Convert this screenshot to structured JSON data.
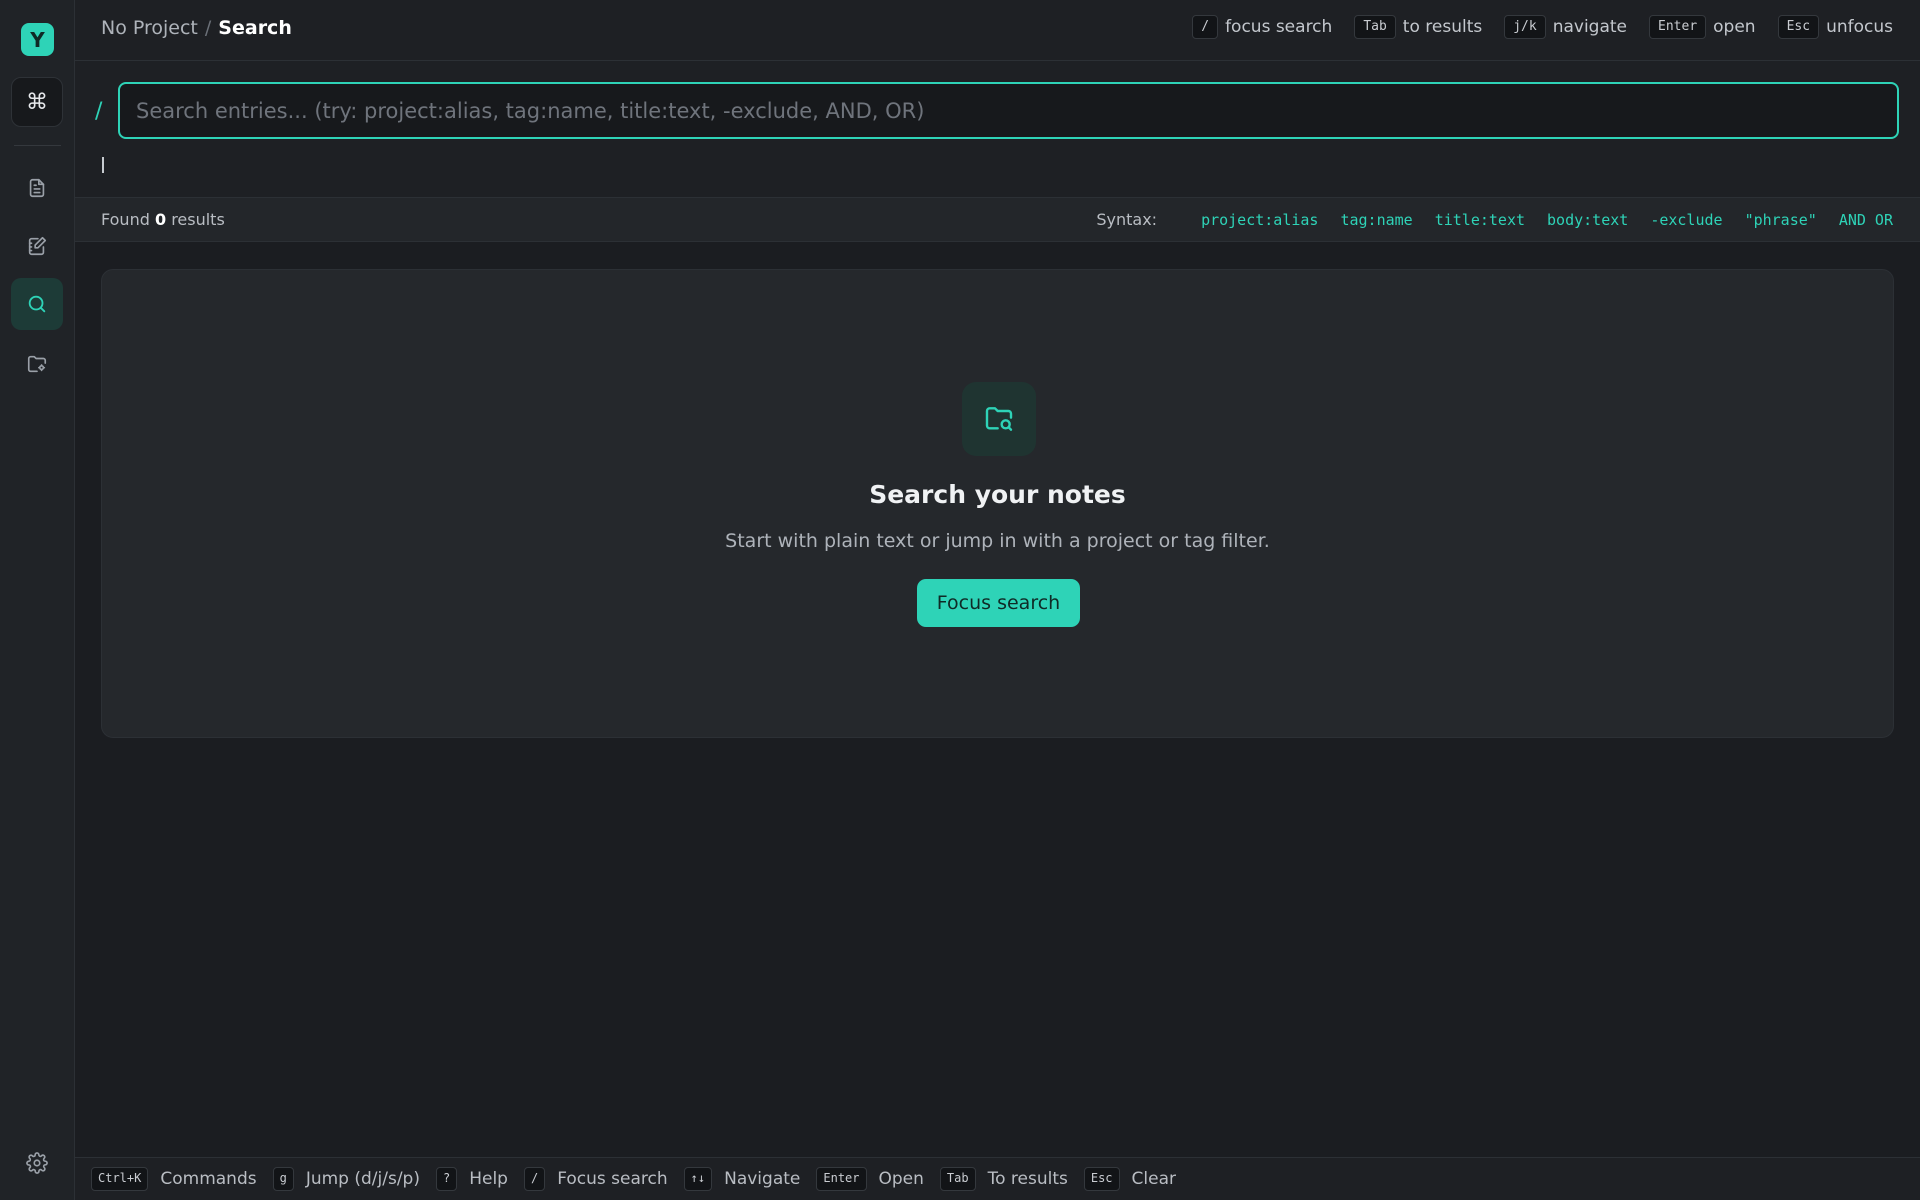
{
  "sidebar": {
    "logo_letter": "Y",
    "command_symbol": "⌘",
    "nav": [
      {
        "name": "notes",
        "icon": "document-icon"
      },
      {
        "name": "journal",
        "icon": "edit-note-icon"
      },
      {
        "name": "search",
        "icon": "search-icon",
        "active": true
      },
      {
        "name": "projects",
        "icon": "folder-icon"
      }
    ],
    "settings_icon": "gear-icon"
  },
  "header": {
    "project": "No Project",
    "separator": "/",
    "page": "Search",
    "hints": [
      {
        "key": "/",
        "label": "focus search"
      },
      {
        "key": "Tab",
        "label": "to results"
      },
      {
        "key": "j/k",
        "label": "navigate"
      },
      {
        "key": "Enter",
        "label": "open"
      },
      {
        "key": "Esc",
        "label": "unfocus"
      }
    ]
  },
  "search": {
    "prefix": "/",
    "value": "",
    "placeholder": "Search entries... (try: project:alias, tag:name, title:text, -exclude, AND, OR)"
  },
  "results": {
    "found_prefix": "Found",
    "count": "0",
    "found_suffix": "results",
    "syntax_label": "Syntax:",
    "syntax": [
      "project:alias",
      "tag:name",
      "title:text",
      "body:text",
      "-exclude",
      "\"phrase\"",
      "AND OR"
    ]
  },
  "empty_state": {
    "icon": "folder-search-icon",
    "title": "Search your notes",
    "subtitle": "Start with plain text or jump in with a project or tag filter.",
    "button": "Focus search"
  },
  "footer": {
    "hints": [
      {
        "key": "Ctrl+K",
        "label": "Commands"
      },
      {
        "key": "g",
        "label": "Jump (d/j/s/p)"
      },
      {
        "key": "?",
        "label": "Help"
      },
      {
        "key": "/",
        "label": "Focus search"
      },
      {
        "key": "↑↓",
        "label": "Navigate"
      },
      {
        "key": "Enter",
        "label": "Open"
      },
      {
        "key": "Tab",
        "label": "To results"
      },
      {
        "key": "Esc",
        "label": "Clear"
      }
    ]
  },
  "colors": {
    "accent": "#2ed3b7",
    "background": "#1b1d21"
  }
}
